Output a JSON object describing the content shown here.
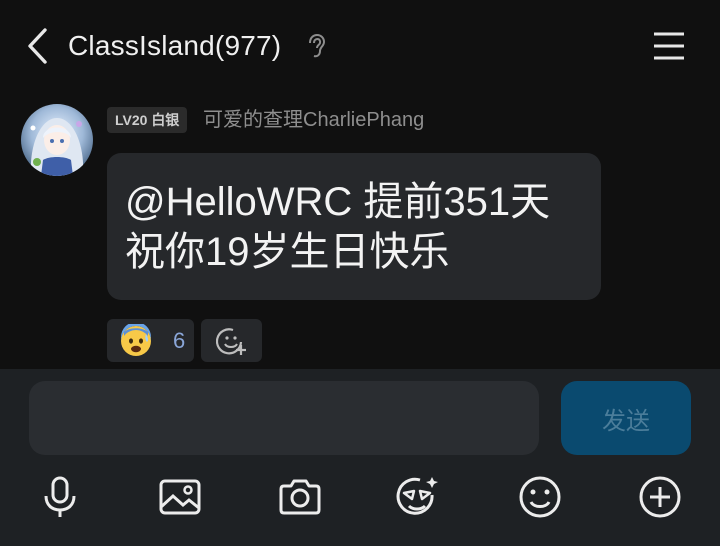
{
  "header": {
    "title": "ClassIsland(977)",
    "back_icon": "chevron-left-icon",
    "ear_icon": "ear-icon",
    "menu_icon": "hamburger-menu-icon"
  },
  "message": {
    "avatar": "avatar-anime-girl",
    "level_badge": "LV20 白银",
    "sender": "可爱的查理CharliePhang",
    "text": "@HelloWRC 提前351天祝你19岁生日快乐",
    "reaction": {
      "emoji": "anxious-sweat-face-emoji",
      "count": "6"
    },
    "add_reaction_icon": "add-emoji-icon"
  },
  "composer": {
    "input_value": "",
    "input_placeholder": "",
    "send_label": "发送"
  },
  "toolbar": {
    "items": [
      "microphone-icon",
      "image-icon",
      "camera-icon",
      "sticker-icon",
      "emoji-icon",
      "plus-icon"
    ]
  },
  "colors": {
    "background": "#101010",
    "bubble": "#26282b",
    "composer_bg": "#1e2124",
    "send_button": "#0a4a6f",
    "reaction_count": "#8aa6d8"
  }
}
